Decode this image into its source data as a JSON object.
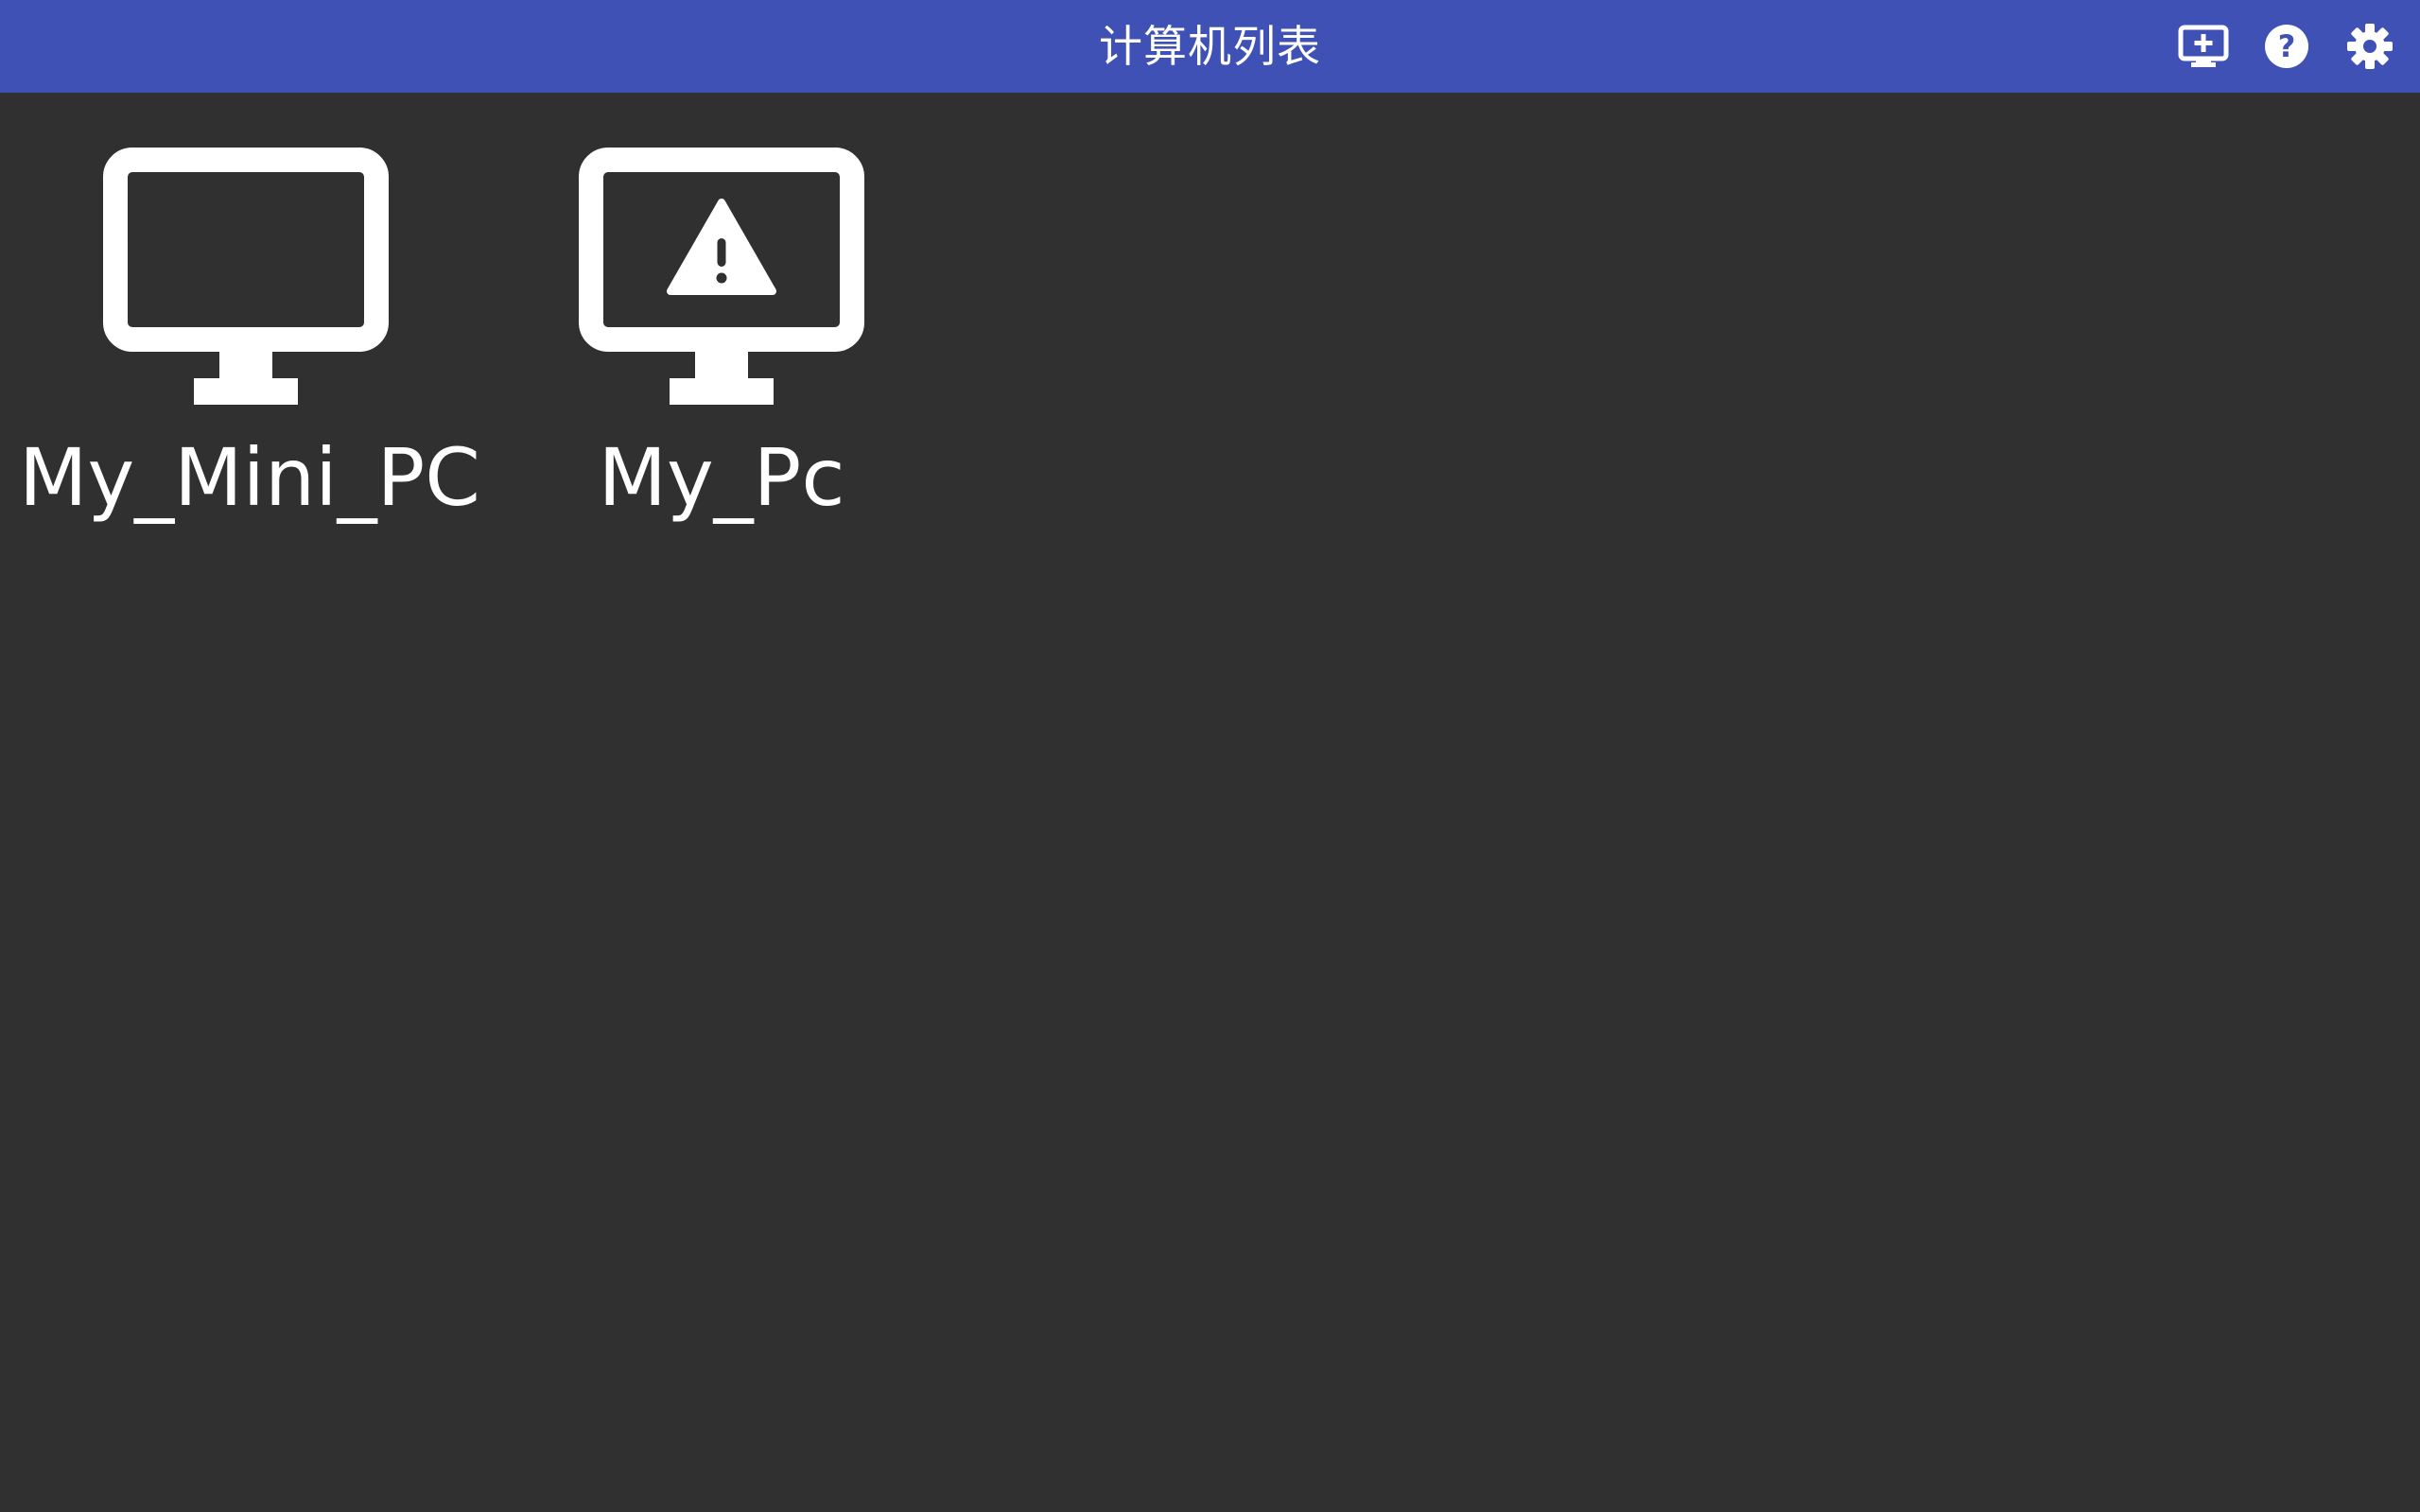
{
  "header": {
    "title": "计算机列表",
    "buttons": [
      {
        "icon": "add-computer-icon"
      },
      {
        "icon": "help-icon"
      },
      {
        "icon": "gear-icon"
      }
    ]
  },
  "computers": [
    {
      "name": "My_Mini_PC",
      "icon": "monitor-icon",
      "status": "normal"
    },
    {
      "name": "My_Pc",
      "icon": "monitor-warning-icon",
      "status": "warning"
    }
  ],
  "colors": {
    "header_bg": "#3f51b5",
    "body_bg": "#303030",
    "foreground": "#ffffff"
  }
}
